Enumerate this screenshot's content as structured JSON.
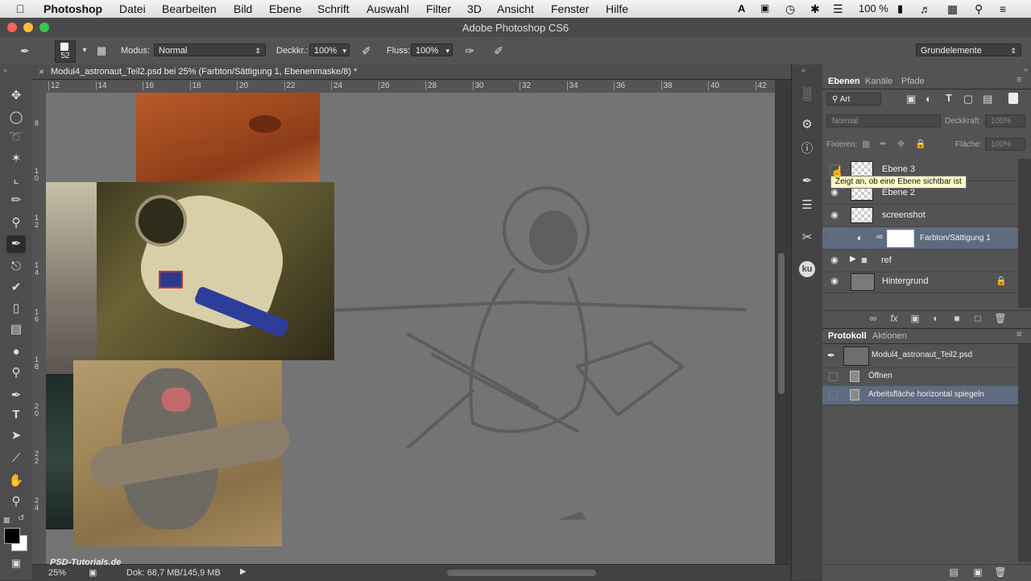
{
  "menubar": {
    "apple_icon": "apple-icon",
    "app_name": "Photoshop",
    "items": [
      "Datei",
      "Bearbeiten",
      "Bild",
      "Ebene",
      "Schrift",
      "Auswahl",
      "Filter",
      "3D",
      "Ansicht",
      "Fenster",
      "Hilfe"
    ],
    "battery": "100 %"
  },
  "window": {
    "title": "Adobe Photoshop CS6"
  },
  "options": {
    "brush_size": "52",
    "mode_label": "Modus:",
    "mode_value": "Normal",
    "opacity_label": "Deckkr.:",
    "opacity_value": "100%",
    "flow_label": "Fluss:",
    "flow_value": "100%",
    "workspace": "Grundelemente"
  },
  "document": {
    "tab_title": "Modul4_astronaut_Teil2.psd bei 25% (Farbton/Sättigung 1, Ebenenmaske/8) *",
    "ruler_top": [
      "12",
      "14",
      "16",
      "18",
      "20",
      "22",
      "24",
      "26",
      "28",
      "30",
      "32",
      "34",
      "36",
      "38",
      "40",
      "42"
    ],
    "ruler_left": [
      "8",
      "1 0",
      "1 2",
      "1 4",
      "1 6",
      "1 8",
      "2 0",
      "2 2",
      "2 4"
    ]
  },
  "status": {
    "zoom": "25%",
    "doc_size": "Dok: 68,7 MB/145,9 MB",
    "watermark": "PSD-Tutorials.de"
  },
  "layers_panel": {
    "tabs": [
      "Ebenen",
      "Kanäle",
      "Pfade"
    ],
    "filter_kind": "Art",
    "blend_mode": "Normal",
    "opacity_label": "Deckkraft:",
    "opacity_value": "100%",
    "lock_label": "Fixieren:",
    "fill_label": "Fläche:",
    "fill_value": "100%",
    "tooltip": "Zeigt an, ob eine Ebene sichtbar ist",
    "layers": [
      {
        "name": "Ebene 3"
      },
      {
        "name": "Ebene 2"
      },
      {
        "name": "screenshot"
      },
      {
        "name": "Farbton/Sättigung 1"
      },
      {
        "name": "ref"
      },
      {
        "name": "Hintergrund"
      }
    ]
  },
  "history_panel": {
    "tabs": [
      "Protokoll",
      "Aktionen"
    ],
    "snapshot": "Modul4_astronaut_Teil2.psd",
    "steps": [
      "Öffnen",
      "Arbeitsfläche horizontal spiegeln"
    ]
  },
  "colors": {
    "accent": "#5e6b7f",
    "panel": "#535353",
    "canvas": "#747474"
  }
}
